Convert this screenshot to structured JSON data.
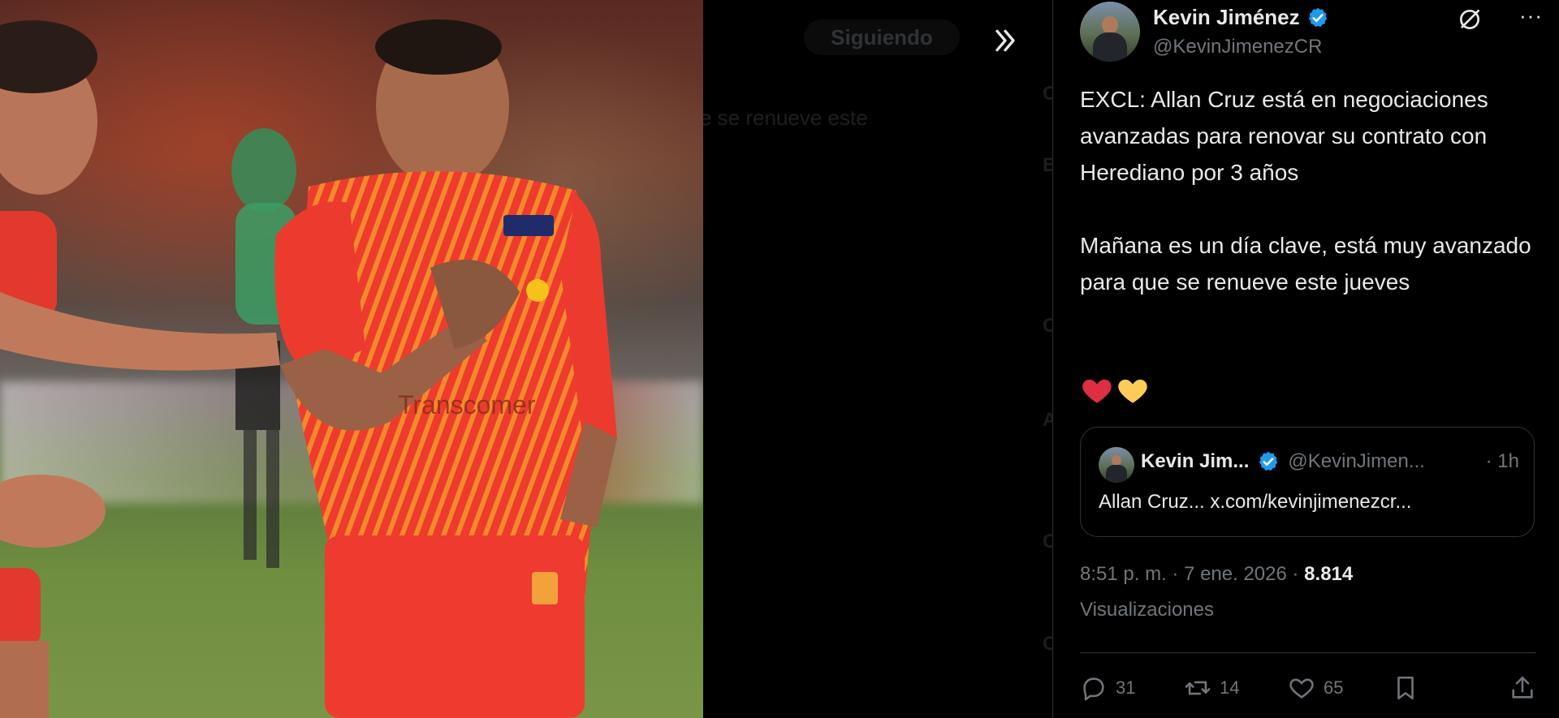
{
  "background_page": {
    "following_button": "Siguiendo",
    "partial_text": "e se renueve este",
    "side_letters": [
      "C",
      "B",
      "C",
      "A",
      "C",
      "C"
    ]
  },
  "tweet": {
    "author": {
      "name": "Kevin Jiménez",
      "handle": "@KevinJimenezCR",
      "verified": true
    },
    "text": "EXCL: Allan Cruz está en negociaciones avanzadas para renovar su contrato con Herediano por 3 años\n\nMañana es un día clave, está muy avanzado para que se renueve este jueves",
    "emojis": [
      "red-heart",
      "yellow-heart"
    ],
    "quoted": {
      "name": "Kevin Jim...",
      "handle": "@KevinJimen...",
      "time": "· 1h",
      "text": "Allan Cruz... x.com/kevinjimenezcr..."
    },
    "timestamp": "8:51 p. m. · 7 ene. 2026 · ",
    "views_count": "8.814",
    "views_label": "Visualizaciones",
    "stats": {
      "replies": "31",
      "reposts": "14",
      "likes": "65"
    }
  },
  "colors": {
    "background": "#000000",
    "text_primary": "#e7e9ea",
    "text_secondary": "#71767b",
    "border": "#2f3336",
    "verified_blue": "#1d9bf0",
    "kit_red": "#e8372c",
    "kit_orange": "#f07a25"
  }
}
